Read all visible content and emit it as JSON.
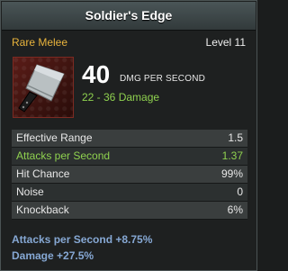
{
  "item": {
    "name": "Soldier's Edge",
    "rarity": "Rare Melee",
    "level": "Level 11",
    "dps_value": "40",
    "dps_label": "DMG PER SECOND",
    "damage_range": "22 - 36 Damage",
    "icon": "cleaver-icon"
  },
  "stats": [
    {
      "label": "Effective Range",
      "value": "1.5"
    },
    {
      "label": "Attacks per Second",
      "value": "1.37"
    },
    {
      "label": "Hit Chance",
      "value": "99%"
    },
    {
      "label": "Noise",
      "value": "0"
    },
    {
      "label": "Knockback",
      "value": "6%"
    }
  ],
  "bonuses": [
    "Attacks per Second +8.75%",
    "Damage +27.5%"
  ],
  "colors": {
    "rarity": "#e8b33c",
    "positive": "#8fd14f",
    "bonus": "#86a8d4"
  }
}
